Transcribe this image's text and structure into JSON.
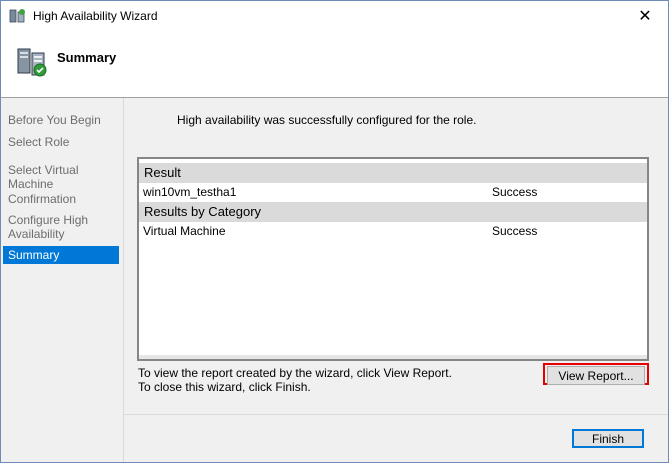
{
  "window": {
    "title": "High Availability Wizard",
    "close_glyph": "✕"
  },
  "header": {
    "title": "Summary"
  },
  "nav": {
    "items": [
      {
        "label": "Before You Begin"
      },
      {
        "label": "Select Role"
      },
      {
        "label": "Select Virtual Machine"
      },
      {
        "label": "Confirmation"
      },
      {
        "label": "Configure High Availability"
      },
      {
        "label": "Summary"
      }
    ],
    "active_index": 5
  },
  "content": {
    "status_message": "High availability was successfully configured for the role.",
    "results": {
      "group1_title": "Result",
      "group1_row": {
        "name": "win10vm_testha1",
        "status": "Success"
      },
      "group2_title": "Results by Category",
      "group2_row": {
        "name": "Virtual Machine",
        "status": "Success"
      }
    },
    "hint_report": "To view the report created by the wizard, click View Report.",
    "hint_close": "To close this wizard, click Finish.",
    "view_report_label": "View Report...",
    "finish_label": "Finish"
  },
  "colors": {
    "accent": "#0078d7",
    "highlight": "#e60000"
  },
  "icons": {
    "app": "cluster-wizard-icon",
    "header": "cluster-server-icon"
  }
}
